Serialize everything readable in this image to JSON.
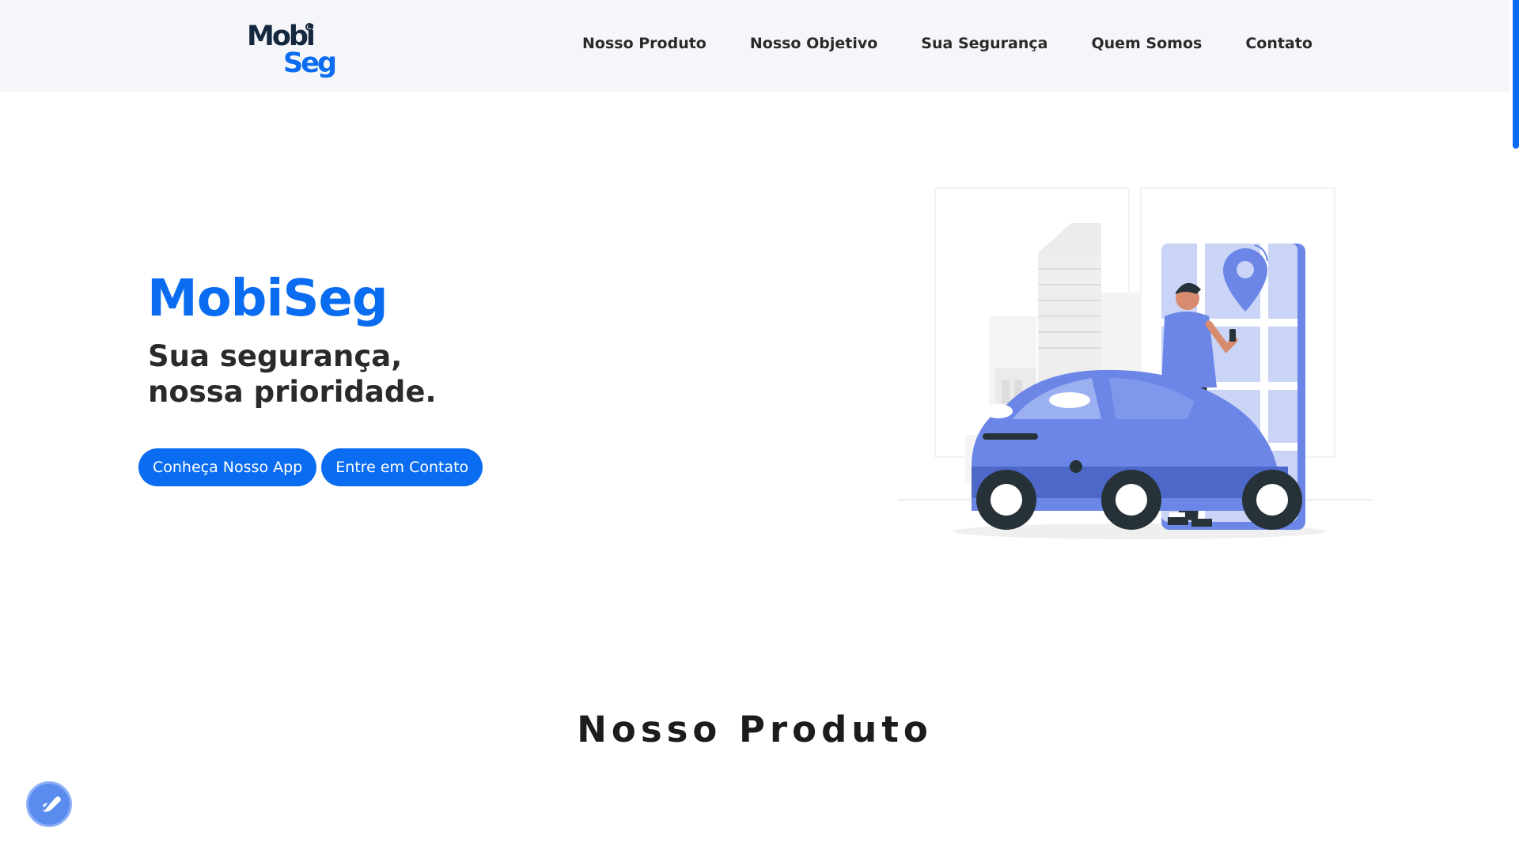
{
  "header": {
    "logo": {
      "line1": "Mobi",
      "line2": "Seg"
    },
    "nav": [
      {
        "label": "Nosso Produto"
      },
      {
        "label": "Nosso Objetivo"
      },
      {
        "label": "Sua Segurança"
      },
      {
        "label": "Quem Somos"
      },
      {
        "label": "Contato"
      }
    ]
  },
  "hero": {
    "title": "MobiSeg",
    "subtitle_line1": "Sua segurança,",
    "subtitle_line2": "nossa prioridade.",
    "buttons": {
      "primary": "Conheça Nosso App",
      "secondary": "Entre em Contato"
    },
    "illustration_icon": "car-with-person-and-map-pin-illustration"
  },
  "sections": {
    "product_title": "Nosso Produto"
  },
  "floating": {
    "accessibility_icon": "accessibility-icon"
  },
  "colors": {
    "brand_blue": "#0a6cf0",
    "logo_dark": "#14283f",
    "header_bg": "#f4f6f9",
    "illustration_blue": "#6b86e6"
  }
}
